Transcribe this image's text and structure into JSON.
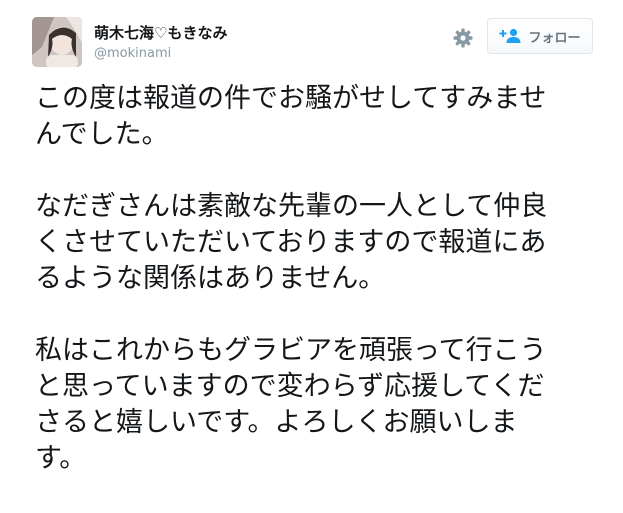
{
  "user": {
    "display_name": "萌木七海♡もきなみ",
    "handle": "@mokinami"
  },
  "actions": {
    "settings_icon": "gear-icon",
    "follow_icon": "follow-person-icon",
    "follow_label": "フォロー"
  },
  "tweet": {
    "paragraphs": [
      [
        "この度は報道の件でお騒がせしてすみませ",
        "んでした。"
      ],
      [
        "なだぎさんは素敵な先輩の一人として仲良",
        "くさせていただいておりますので報道にあ",
        "るような関係はありません。"
      ],
      [
        "私はこれからもグラビアを頑張って行こう",
        "と思っていますので変わらず応援してくだ",
        "さると嬉しいです。よろしくお願いしま",
        "す。"
      ]
    ]
  },
  "colors": {
    "text": "#14171a",
    "secondary_text": "#8899a6",
    "accent": "#1da1f2",
    "button_border": "#e1e8ed"
  }
}
